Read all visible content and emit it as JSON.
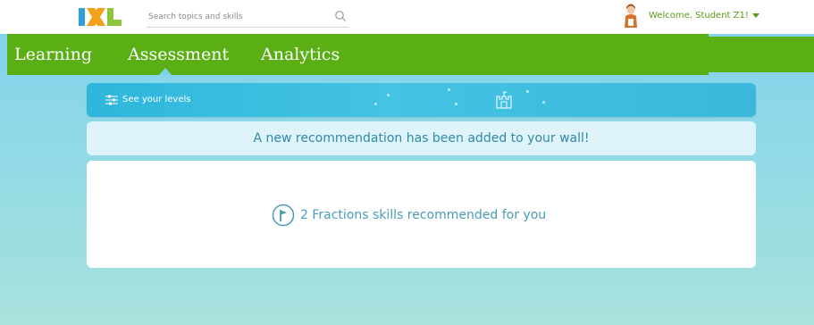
{
  "header": {
    "logo_text": "IXL",
    "search_placeholder": "Search topics and skills",
    "welcome_text": "Welcome, Student Z1!"
  },
  "nav": {
    "items": [
      {
        "label": "Learning"
      },
      {
        "label": "Assessment",
        "active": true
      },
      {
        "label": "Analytics"
      }
    ]
  },
  "levels_banner": {
    "label": "See your levels"
  },
  "notice": {
    "text": "A new recommendation has been added to your wall!"
  },
  "recommendation": {
    "text": "2 Fractions skills recommended for you"
  },
  "colors": {
    "nav_green": "#5aaf14",
    "banner_blue": "#44c3e3",
    "text_teal": "#4a9bb8"
  }
}
